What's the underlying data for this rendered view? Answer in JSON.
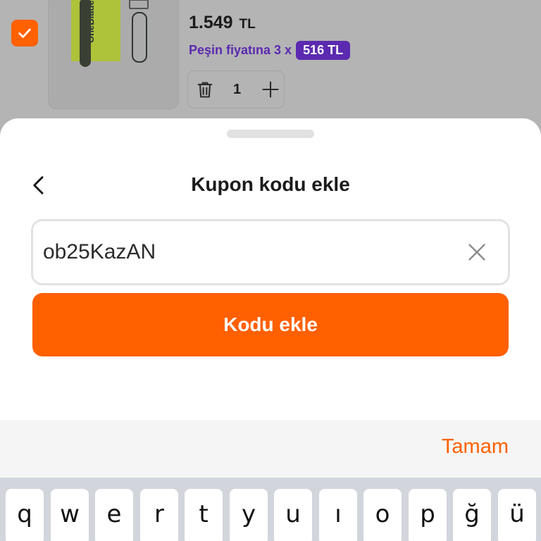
{
  "cart_item": {
    "product_brand": "OneBlade",
    "price": "1.549",
    "currency": "TL",
    "installment_text": "Peşin fiyatına 3 x",
    "installment_badge": "516 TL",
    "quantity": "1"
  },
  "sheet": {
    "title": "Kupon kodu ekle",
    "coupon_value": "ob25KazAN",
    "submit_label": "Kodu ekle"
  },
  "keyboard": {
    "done_label": "Tamam",
    "keys": [
      "q",
      "w",
      "e",
      "r",
      "t",
      "y",
      "u",
      "ı",
      "o",
      "p",
      "ğ",
      "ü"
    ]
  },
  "colors": {
    "accent": "#ff6000",
    "installment_purple": "#5b2ab0"
  }
}
